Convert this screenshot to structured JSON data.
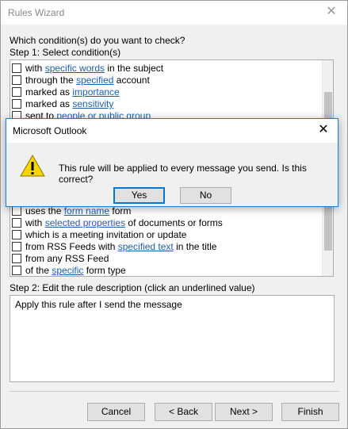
{
  "window": {
    "title": "Rules Wizard"
  },
  "prompt": "Which condition(s) do you want to check?",
  "step1": "Step 1: Select condition(s)",
  "conditions_top": [
    {
      "pre": "with ",
      "link": "specific words",
      "post": " in the subject"
    },
    {
      "pre": "through the ",
      "link": "specified",
      "post": " account"
    },
    {
      "pre": "marked as ",
      "link": "importance",
      "post": ""
    },
    {
      "pre": "marked as ",
      "link": "sensitivity",
      "post": ""
    },
    {
      "pre": "sent to ",
      "link": "people or public group",
      "post": ""
    }
  ],
  "conditions_bottom": [
    {
      "pre": "uses the ",
      "link": "form name",
      "post": " form"
    },
    {
      "pre": "with ",
      "link": "selected properties",
      "post": " of documents or forms"
    },
    {
      "pre": "which is a meeting invitation or update",
      "link": "",
      "post": ""
    },
    {
      "pre": "from RSS Feeds with ",
      "link": "specified text",
      "post": " in the title"
    },
    {
      "pre": "from any RSS Feed",
      "link": "",
      "post": ""
    },
    {
      "pre": "of the ",
      "link": "specific",
      "post": " form type"
    }
  ],
  "step2": "Step 2: Edit the rule description (click an underlined value)",
  "description": "Apply this rule after I send the message",
  "buttons": {
    "cancel": "Cancel",
    "back": "< Back",
    "next": "Next >",
    "finish": "Finish"
  },
  "dialog": {
    "title": "Microsoft Outlook",
    "message": "This rule will be applied to every message you send. Is this correct?",
    "yes": "Yes",
    "no": "No",
    "icon": "warning-icon"
  },
  "colors": {
    "link": "#1a5fb4",
    "warning": "#f7d600",
    "accent": "#0078d7"
  }
}
